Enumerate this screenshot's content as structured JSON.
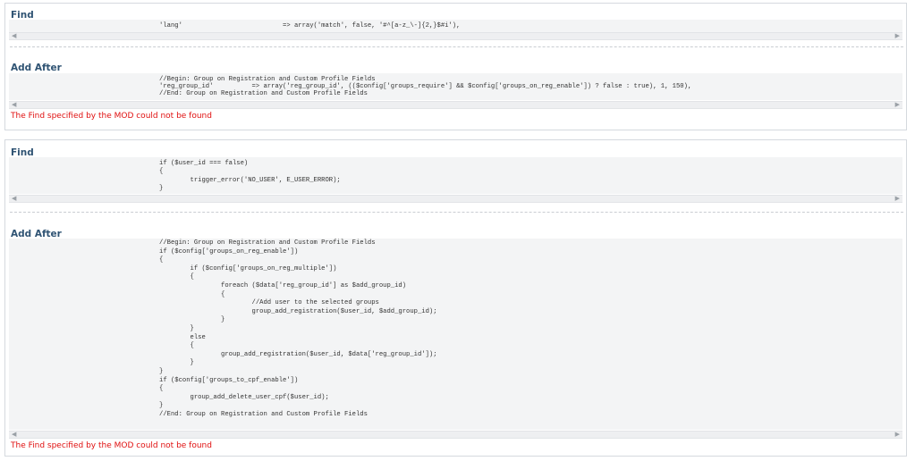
{
  "panels": [
    {
      "find_label": "Find",
      "find_code": "'lang'                          => array('match', false, '#^[a-z_\\-]{2,}$#i'),",
      "add_after_label": "Add After",
      "add_after_code": "//Begin: Group on Registration and Custom Profile Fields\n'reg_group_id'          => array('reg_group_id', (($config['groups_require'] && $config['groups_on_reg_enable']) ? false : true), 1, 150),\n//End: Group on Registration and Custom Profile Fields",
      "error": "The Find specified by the MOD could not be found"
    },
    {
      "find_label": "Find",
      "find_code": "if ($user_id === false)\n{\n        trigger_error('NO_USER', E_USER_ERROR);\n}",
      "add_after_label": "Add After",
      "add_after_code": "//Begin: Group on Registration and Custom Profile Fields\nif ($config['groups_on_reg_enable'])\n{\n        if ($config['groups_on_reg_multiple'])\n        {\n                foreach ($data['reg_group_id'] as $add_group_id)\n                {\n                        //Add user to the selected groups\n                        group_add_registration($user_id, $add_group_id);\n                }\n        }\n        else\n        {\n                group_add_registration($user_id, $data['reg_group_id']);\n        }\n}\nif ($config['groups_to_cpf_enable'])\n{\n        group_add_delete_user_cpf($user_id);\n}\n//End: Group on Registration and Custom Profile Fields",
      "error": "The Find specified by the MOD could not be found"
    }
  ],
  "scroll_icons": {
    "left": "arrow-left-icon",
    "right": "arrow-right-icon"
  },
  "colors": {
    "label": "#2f5373",
    "error": "#e01010",
    "code_bg": "#f3f4f5"
  }
}
